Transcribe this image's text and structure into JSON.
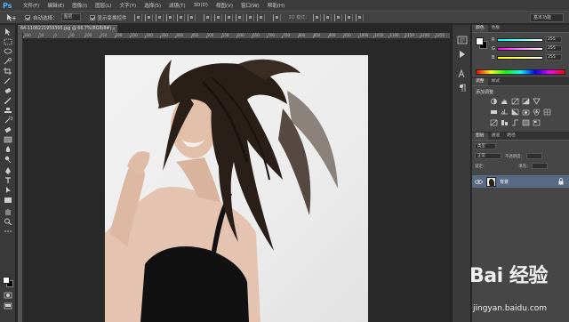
{
  "app": {
    "logo": "Ps"
  },
  "menu": [
    "文件(F)",
    "编辑(E)",
    "图像(I)",
    "图层(L)",
    "文字(Y)",
    "选择(S)",
    "滤镜(T)",
    "3D(D)",
    "视图(V)",
    "窗口(W)",
    "帮助(H)"
  ],
  "options": {
    "auto_select_label": "自动选择：",
    "auto_select_value": "图层",
    "show_transform_label": "显示变换控件",
    "mode_3d_label": "3D 模式：",
    "workspace": "基本功能"
  },
  "document": {
    "tab_title": "64-1106221959395.jpg @ 66.7%(RGB/8#)",
    "close": "×"
  },
  "ruler": {
    "labels": [
      "100",
      "50",
      "0",
      "50",
      "100",
      "150",
      "200",
      "250",
      "300",
      "350",
      "400",
      "450",
      "500",
      "550",
      "600",
      "650",
      "700",
      "750",
      "800",
      "850",
      "900",
      "950",
      "1000",
      "1050",
      "1100",
      "1150",
      "1200",
      "1250"
    ]
  },
  "color_panel": {
    "tabs": [
      "颜色",
      "色板"
    ],
    "channels": [
      {
        "letter": "R",
        "value": "255",
        "gradient": "#ff6060"
      },
      {
        "letter": "G",
        "value": "255",
        "gradient": "#60ff60"
      },
      {
        "letter": "B",
        "value": "255",
        "gradient": "#6060ff"
      }
    ],
    "foreground": "#ffffff",
    "background": "#000000"
  },
  "adjustments_panel": {
    "tabs": [
      "调整",
      "样式"
    ],
    "title": "添加调整"
  },
  "layers_panel": {
    "tabs": [
      "图层",
      "通道",
      "路径"
    ],
    "kind_label": "类型",
    "blend_mode": "正常",
    "opacity_label": "不透明度：",
    "lock_label": "锁定：",
    "fill_label": "填充：",
    "layers": [
      {
        "name": "背景",
        "visible": true,
        "locked": true
      }
    ]
  },
  "watermark": {
    "logo": "Bai 经验",
    "url": "jingyan.baidu.com"
  }
}
